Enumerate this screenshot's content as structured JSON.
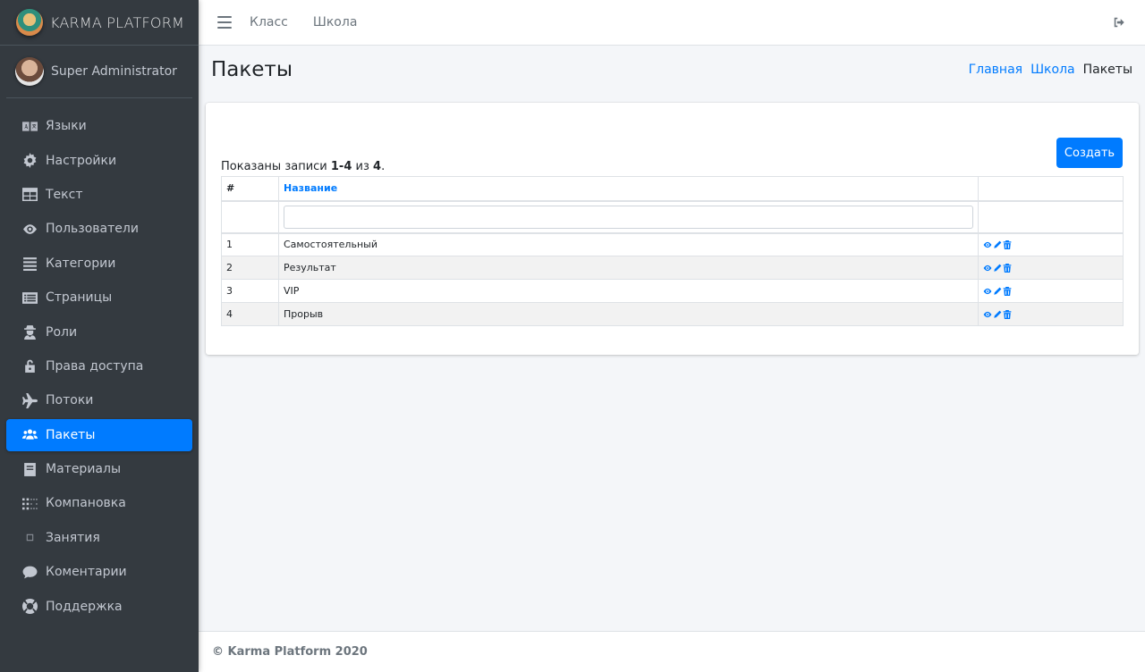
{
  "brand": {
    "name": "KARMA PLATFORM"
  },
  "user": {
    "name": "Super Administrator"
  },
  "sidebar": {
    "items": [
      {
        "label": "Языки",
        "icon": "language-icon",
        "active": false
      },
      {
        "label": "Настройки",
        "icon": "gear-icon",
        "active": false
      },
      {
        "label": "Текст",
        "icon": "table-icon",
        "active": false
      },
      {
        "label": "Пользователи",
        "icon": "eye-icon",
        "active": false
      },
      {
        "label": "Категории",
        "icon": "list-icon",
        "active": false
      },
      {
        "label": "Страницы",
        "icon": "list-alt-icon",
        "active": false
      },
      {
        "label": "Роли",
        "icon": "user-secret-icon",
        "active": false
      },
      {
        "label": "Права доступа",
        "icon": "unlock-icon",
        "active": false
      },
      {
        "label": "Потоки",
        "icon": "plane-icon",
        "active": false
      },
      {
        "label": "Пакеты",
        "icon": "users-icon",
        "active": true
      },
      {
        "label": "Материалы",
        "icon": "book-icon",
        "active": false
      },
      {
        "label": "Компановка",
        "icon": "grid-dots-icon",
        "active": false
      },
      {
        "label": "Занятия",
        "icon": "square-outline-icon",
        "active": false
      },
      {
        "label": "Коментарии",
        "icon": "comment-icon",
        "active": false
      },
      {
        "label": "Поддержка",
        "icon": "life-ring-icon",
        "active": false
      }
    ]
  },
  "topbar": {
    "links": [
      "Класс",
      "Школа"
    ]
  },
  "page": {
    "title": "Пакеты",
    "breadcrumb": [
      {
        "label": "Главная",
        "link": true
      },
      {
        "label": "Школа",
        "link": true
      },
      {
        "label": "Пакеты",
        "link": false
      }
    ]
  },
  "card": {
    "create_label": "Создать",
    "summary": {
      "prefix": "Показаны записи ",
      "range": "1-4",
      "of": " из ",
      "total": "4",
      "suffix": "."
    },
    "table": {
      "headers": {
        "num": "#",
        "name": "Название"
      },
      "filter_placeholder": "",
      "rows": [
        {
          "num": "1",
          "name": "Самостоятельный"
        },
        {
          "num": "2",
          "name": "Результат"
        },
        {
          "num": "3",
          "name": "VIP"
        },
        {
          "num": "4",
          "name": "Прорыв"
        }
      ]
    }
  },
  "footer": {
    "text": "© Karma Platform 2020"
  },
  "colors": {
    "sidebar_bg": "#343a40",
    "accent": "#007bff",
    "content_bg": "#f4f6f9"
  }
}
